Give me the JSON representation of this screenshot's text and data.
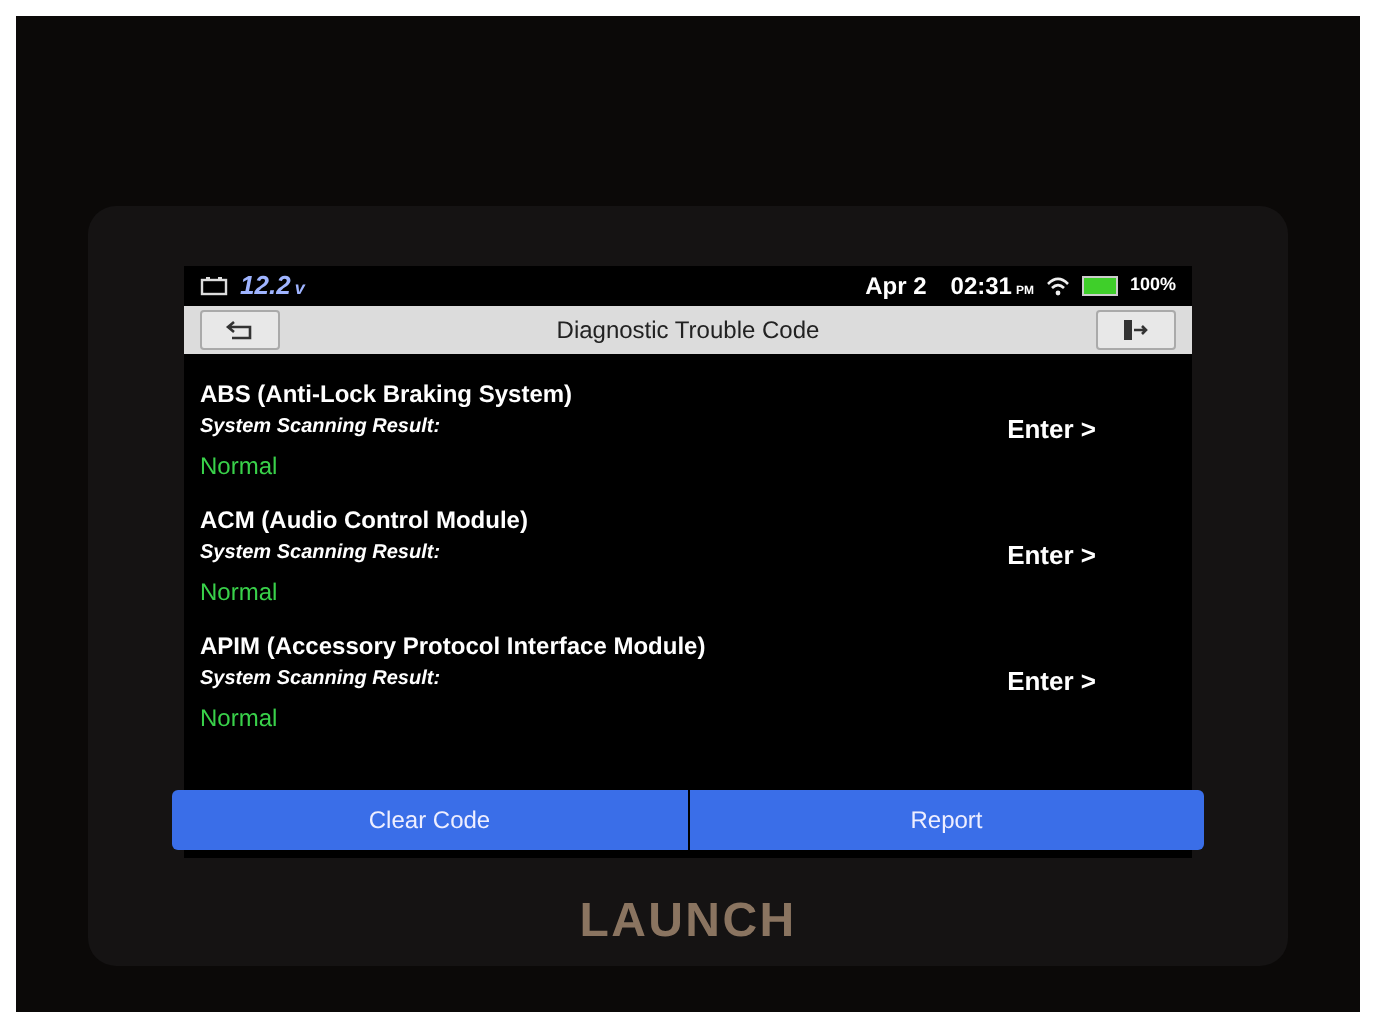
{
  "status_bar": {
    "voltage": "12.2",
    "voltage_unit": "v",
    "date": "Apr 2",
    "time": "02:31",
    "ampm": "PM",
    "battery": "100%"
  },
  "title_bar": {
    "title": "Diagnostic Trouble Code"
  },
  "systems": [
    {
      "name": "ABS (Anti-Lock Braking System)",
      "result_label": "System Scanning Result:",
      "result": "Normal",
      "action": "Enter >"
    },
    {
      "name": "ACM (Audio Control Module)",
      "result_label": "System Scanning Result:",
      "result": "Normal",
      "action": "Enter >"
    },
    {
      "name": "APIM (Accessory Protocol Interface Module)",
      "result_label": "System Scanning Result:",
      "result": "Normal",
      "action": "Enter >"
    }
  ],
  "buttons": [
    "Clear Code",
    "Report"
  ],
  "device": {
    "brand": "LAUNCH"
  }
}
